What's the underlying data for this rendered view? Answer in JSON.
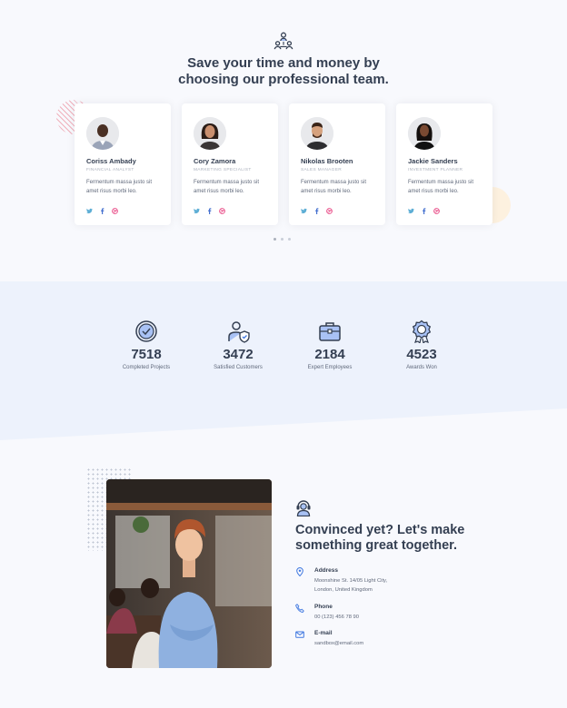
{
  "team": {
    "heading_line1": "Save your time and money by",
    "heading_line2": "choosing our professional team.",
    "members": [
      {
        "name": "Coriss Ambady",
        "role": "FINANCIAL ANALYST",
        "bio": "Fermentum massa justo sit amet risus morbi leo."
      },
      {
        "name": "Cory Zamora",
        "role": "MARKETING SPECIALIST",
        "bio": "Fermentum massa justo sit amet risus morbi leo."
      },
      {
        "name": "Nikolas Brooten",
        "role": "SALES MANAGER",
        "bio": "Fermentum massa justo sit amet risus morbi leo."
      },
      {
        "name": "Jackie Sanders",
        "role": "INVESTMENT PLANNER",
        "bio": "Fermentum massa justo sit amet risus morbi leo."
      }
    ],
    "social_icons": [
      "twitter-icon",
      "facebook-icon",
      "dribbble-icon"
    ],
    "carousel_pages": 3,
    "carousel_active": 1
  },
  "stats": [
    {
      "icon": "check-badge-icon",
      "value": "7518",
      "label": "Completed Projects"
    },
    {
      "icon": "user-shield-icon",
      "value": "3472",
      "label": "Satisfied Customers"
    },
    {
      "icon": "briefcase-icon",
      "value": "2184",
      "label": "Expert Employees"
    },
    {
      "icon": "award-icon",
      "value": "4523",
      "label": "Awards Won"
    }
  ],
  "contact": {
    "heading_line1": "Convinced yet? Let's make",
    "heading_line2": "something great together.",
    "address_title": "Address",
    "address_line1": "Moonshine St. 14/05 Light City,",
    "address_line2": "London, United Kingdom",
    "phone_title": "Phone",
    "phone_value": "00 (123) 456 78 90",
    "email_title": "E-mail",
    "email_value": "sandbox@email.com"
  },
  "colors": {
    "accent": "#3f78e0",
    "heading": "#343f52",
    "body_text": "#60697b",
    "twitter": "#5daed5",
    "facebook": "#4470cf",
    "dribbble": "#e94d88",
    "stats_bg": "#edf2fc"
  }
}
